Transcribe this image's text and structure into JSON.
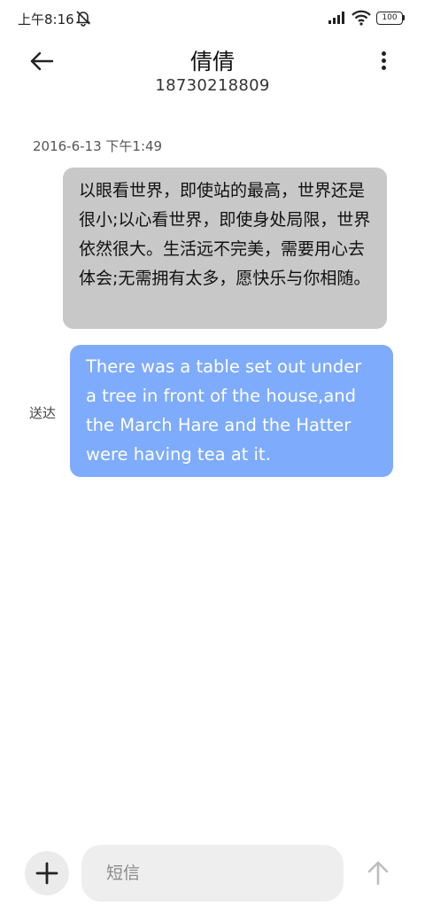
{
  "status_bar": {
    "time": "上午8:16",
    "battery_level": "100",
    "icons": [
      "mute-icon",
      "signal-icon",
      "wifi-icon",
      "battery-icon"
    ]
  },
  "header": {
    "contact_name": "倩倩",
    "phone_number": "18730218809",
    "back_icon": "arrow-left-icon",
    "menu_icon": "more-vertical-icon"
  },
  "conversation": {
    "timestamp": "2016-6-13 下午1:49",
    "messages": [
      {
        "direction": "received",
        "text": "以眼看世界，即使站的最高，世界还是很小;以心看世界，即使身处局限，世界依然很大。生活远不完美，需要用心去体会;无需拥有太多，愿快乐与你相随。"
      },
      {
        "direction": "sent",
        "text": "There was a table set out under a tree in front of the house,and the March Hare and the Hatter were having tea at it.",
        "status": "送达"
      }
    ]
  },
  "composer": {
    "placeholder": "短信",
    "value": "",
    "add_icon": "plus-icon",
    "send_icon": "arrow-up-icon"
  },
  "colors": {
    "received_bubble": "#c8c8c8",
    "sent_bubble": "#7eabfb",
    "input_background": "#eeeeee"
  }
}
